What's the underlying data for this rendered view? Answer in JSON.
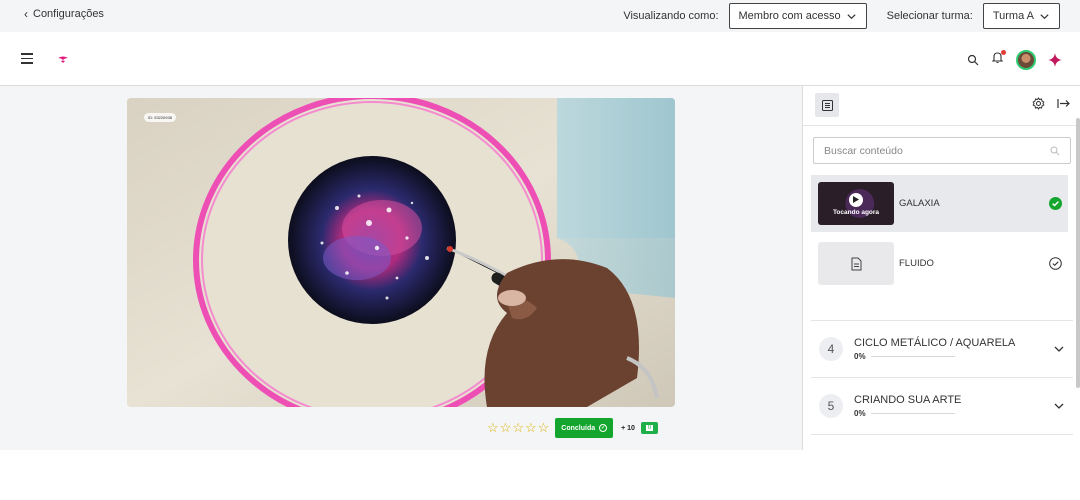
{
  "topbar": {
    "back_label": "Configurações",
    "viewing_as_label": "Visualizando como:",
    "viewing_as_value": "Membro com acesso",
    "select_class_label": "Selecionar turma:",
    "select_class_value": "Turma A"
  },
  "video": {
    "id_badge": "ID: 53226938"
  },
  "lesson_actions": {
    "rating_stars": 0,
    "done_label": "Concluída",
    "points": "+ 10",
    "ticket_value": "0"
  },
  "sidebar": {
    "search_placeholder": "Buscar conteúdo",
    "lessons": [
      {
        "title": "GALAXIA",
        "thumb_label": "Tocando agora",
        "status": "completed",
        "active": true
      },
      {
        "title": "FLUIDO",
        "status": "pending",
        "active": false
      }
    ],
    "modules": [
      {
        "number": "4",
        "title": "CICLO METÁLICO / AQUARELA",
        "progress_label": "0%",
        "progress": 0
      },
      {
        "number": "5",
        "title": "CRIANDO SUA ARTE",
        "progress_label": "0%",
        "progress": 0
      }
    ]
  },
  "colors": {
    "accent_green": "#13a52e",
    "brand_pink": "#e0197d",
    "notification_red": "#e53935"
  }
}
